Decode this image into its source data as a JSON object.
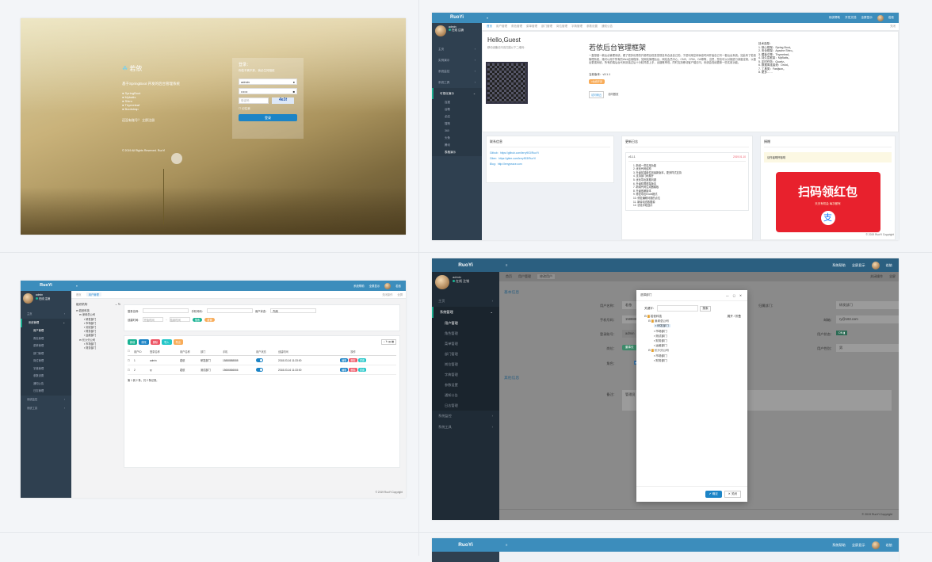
{
  "login": {
    "brand": "若依",
    "tagline": "基于SpringBoot 开发的后台管理系统",
    "features": [
      "SpringBoot",
      "Mybatis",
      "Shiro",
      "Thymeleaf",
      "Bootstrap"
    ],
    "register_link": "还没有账号？ 立即注册",
    "copyright": "© 2019 All Rights Reserved. RuoYi",
    "form_title": "登录：",
    "form_hint": "你若不离不弃，我必生死相依",
    "username": "admin",
    "password": "••••••",
    "captcha_placeholder": "验证码",
    "captcha_image": "4e3t",
    "remember": "记住我",
    "submit": "登录"
  },
  "dash": {
    "logo": "RuoYi",
    "user": "admin",
    "online": "在线",
    "logout": "注销",
    "toolbar": [
      "系统帮助",
      "开发文档",
      "全屏显示",
      "若依"
    ],
    "tabs": [
      "首页",
      "用户管理",
      "角色管理",
      "菜单管理",
      "部门管理",
      "岗位管理",
      "字典管理",
      "参数设置",
      "通知公告"
    ],
    "tab_close": "关闭",
    "menu": [
      "主页",
      "实例演示",
      "系统监控",
      "系统工具",
      "可视化演示"
    ],
    "submenu": [
      "百度",
      "谷歌",
      "必应",
      "搜狗",
      "360",
      "头条",
      "腾讯"
    ],
    "submenu_last": "表格演示",
    "hello": "Hello,Guest",
    "hello_sub": "移动设备访问请扫描以下二维码：",
    "title": "若依后台管理框架",
    "desc": "一直想做一款后台管理系统，看了很多优秀的开源项目但是发现没有合适自己的。于是利用空闲休息时间开始自己写一套后台系统。如此有了若依管理系统，她可以用于所有的Web应用程序，如网站管理后台，网站会员中心，CMS，CRM，OA等等，当然，您也可以对她进行深度定制，以做出更强系统。所有前端后台代码封装过后十分精简易上手，出错概率低。同时支持移动客户端访问。系统会陆续更新一些实用功能。",
    "version": "当前版本：v3.1.1",
    "price": "¥免费开源",
    "btn_visit": "访问码云",
    "btn_github": "访问首页",
    "tech_title": "技术选型：",
    "tech": [
      "1. 核心框架：Spring Boot。",
      "2. 安全框架：Apache Shiro。",
      "3. 模板引擎：Thymeleaf。",
      "4. 持久层框架：MyBatis。",
      "5. 定时任务：Quartz。",
      "6. 数据库连接池：Druid。",
      "7. 工具类：Fastjson。",
      "8. 更多……"
    ],
    "contact_title": "联系信息",
    "contacts": [
      "Github：https://github.com/lerry903/RuoYi",
      "Gitee：https://gitee.com/lerry903/RuoYi",
      "Blog：http://lerrypeace.com"
    ],
    "log_title": "更新日志",
    "log_version": "v3.1.1",
    "log_date": "2019.01.10",
    "log_items": [
      "1. 新增一些实用功能",
      "2. 优化代码结构",
      "3. 升级前端组件到最新版本，更多样式支持",
      "4. 支持部门树展开",
      "5. 优化导出数据问题",
      "6. 升级权限框架版本",
      "7. 新增代码生成器模板",
      "8. 升级依赖版本",
      "9. 修复导出Excel格式",
      "10. 修复编辑问题的点位",
      "11. 新增动态数据源",
      "12. 优化字段显示"
    ],
    "donate_title": "捐赠",
    "donate_note": "请作者喝杯咖啡",
    "hongbao": "扫码领红包",
    "hongbao_sub": "天天有机会 每次都有",
    "copyright": "© 2019 RuoYi Copyright"
  },
  "user": {
    "logo": "RuoYi",
    "user": "admin",
    "online": "在线",
    "logout": "注销",
    "toolbar": [
      "系统帮助",
      "全屏显示",
      "若依"
    ],
    "tabs": [
      "首页",
      "用户管理"
    ],
    "tab_actions": [
      "关闭操作",
      "全屏"
    ],
    "menu": [
      "主页",
      "系统管理",
      "系统监控",
      "系统工具"
    ],
    "submenu": [
      "用户管理",
      "角色管理",
      "菜单管理",
      "部门管理",
      "岗位管理",
      "字典管理",
      "参数设置",
      "通知公告",
      "日志管理"
    ],
    "tree_title": "组织机构",
    "tree": [
      "若依科技",
      "深圳总公司",
      "研发部门",
      "市场部门",
      "测试部门",
      "财务部门",
      "运维部门",
      "长沙分公司",
      "市场部门",
      "财务部门"
    ],
    "search": {
      "login_label": "登录名称：",
      "phone_label": "手机号码：",
      "status_label": "用户状态：",
      "status_value": "所有",
      "time_label": "创建时间：",
      "start": "开始时间",
      "end": "结束时间",
      "search": "搜索",
      "reset": "重置"
    },
    "actions": [
      "新增",
      "修改",
      "删除",
      "导入",
      "导出"
    ],
    "columns": [
      "用户ID",
      "登录名称",
      "用户名称",
      "部门",
      "手机",
      "用户状态",
      "创建时间",
      "操作"
    ],
    "rows": [
      [
        "1",
        "admin",
        "若依",
        "研发部门",
        "15888888888",
        "2018-03-16 11:33:00"
      ],
      [
        "2",
        "ry",
        "若依",
        "测试部门",
        "15666666666",
        "2018-03-16 11:33:00"
      ]
    ],
    "row_ops": [
      "编辑",
      "删除",
      "重置"
    ],
    "pager": "第 1 到 2 条，共 2 条记录。",
    "copyright": "© 2019 RuoYi Copyright"
  },
  "edit": {
    "logo": "RuoYi",
    "user": "admin",
    "online": "在线",
    "logout": "注销",
    "toolbar": [
      "系统帮助",
      "全屏显示",
      "若依"
    ],
    "tabs": [
      "首页",
      "用户管理",
      "修改用户"
    ],
    "tab_actions": [
      "关闭操作",
      "全屏"
    ],
    "menu": [
      "主页",
      "系统管理",
      "系统监控",
      "系统工具"
    ],
    "submenu": [
      "用户管理",
      "角色管理",
      "菜单管理",
      "部门管理",
      "岗位管理",
      "字典管理",
      "参数设置",
      "通知公告",
      "日志管理"
    ],
    "section1": "基本信息",
    "section2": "其他信息",
    "fields": {
      "name_label": "用户名称：",
      "name": "若依",
      "phone_label": "手机号码：",
      "phone": "15888888888",
      "login_label": "登录账号：",
      "login": "admin",
      "dept_label": "归属部门：",
      "dept": "研发部门",
      "email_label": "邮箱：",
      "email": "ry@163.com",
      "status_label": "用户状态：",
      "status": "ON",
      "post_label": "岗位：",
      "post": "董事长",
      "sex_label": "用户性别：",
      "sex": "男",
      "role_label": "角色：",
      "role1": "管理员",
      "role2": "普通角色",
      "remark_label": "备注：",
      "remark": "管理员"
    },
    "modal": {
      "title": "选择部门",
      "keyword_label": "关键字：",
      "search": "搜索",
      "expand": "展开",
      "collapse": "折叠",
      "tree": [
        "若依科技",
        "深圳总公司",
        "研发部门",
        "市场部门",
        "测试部门",
        "财务部门",
        "运维部门",
        "长沙分公司",
        "市场部门",
        "财务部门"
      ],
      "ok": "确定",
      "close": "关闭"
    },
    "copyright": "© 2019 RuoYi Copyright"
  },
  "next": {
    "logo": "RuoYi",
    "toolbar": [
      "系统帮助",
      "全屏显示",
      "若依"
    ]
  }
}
